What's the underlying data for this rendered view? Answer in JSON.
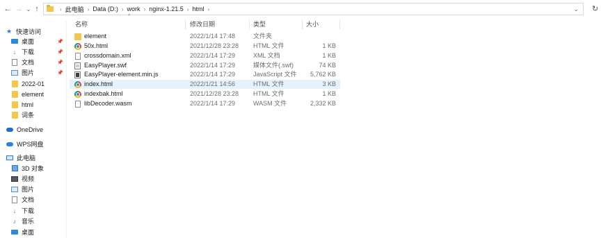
{
  "nav": {
    "back_icon": "arrow-left-icon",
    "forward_icon": "arrow-right-icon",
    "down_icon": "chevron-down-icon",
    "up_icon": "arrow-up-icon"
  },
  "address": {
    "crumbs": [
      "此电脑",
      "Data (D:)",
      "work",
      "nginx-1.21.5",
      "html"
    ]
  },
  "sidebar": {
    "quick_access": "快速访问",
    "items": [
      {
        "label": "桌面",
        "icon": "desktop-icon",
        "pinned": true
      },
      {
        "label": "下载",
        "icon": "download-icon",
        "pinned": true
      },
      {
        "label": "文档",
        "icon": "document-icon",
        "pinned": true
      },
      {
        "label": "图片",
        "icon": "picture-icon",
        "pinned": true
      },
      {
        "label": "2022-01",
        "icon": "folder-icon",
        "pinned": false
      },
      {
        "label": "element",
        "icon": "folder-icon",
        "pinned": false
      },
      {
        "label": "html",
        "icon": "folder-icon",
        "pinned": false
      },
      {
        "label": "词条",
        "icon": "folder-icon",
        "pinned": false
      }
    ],
    "onedrive": "OneDrive",
    "wps": "WPS网盘",
    "this_pc": "此电脑",
    "pc_items": [
      {
        "label": "3D 对象",
        "icon": "3d-objects-icon"
      },
      {
        "label": "视频",
        "icon": "video-icon"
      },
      {
        "label": "图片",
        "icon": "picture-icon"
      },
      {
        "label": "文档",
        "icon": "document-icon"
      },
      {
        "label": "下载",
        "icon": "download-icon"
      },
      {
        "label": "音乐",
        "icon": "music-icon"
      },
      {
        "label": "桌面",
        "icon": "desktop-icon"
      }
    ]
  },
  "columns": {
    "name": "名称",
    "date": "修改日期",
    "type": "类型",
    "size": "大小"
  },
  "files": [
    {
      "name": "element",
      "date": "2022/1/14 17:48",
      "type": "文件夹",
      "size": "",
      "icon": "folder-icon"
    },
    {
      "name": "50x.html",
      "date": "2021/12/28 23:28",
      "type": "HTML 文件",
      "size": "1 KB",
      "icon": "chrome-icon"
    },
    {
      "name": "crossdomain.xml",
      "date": "2022/1/14 17:29",
      "type": "XML 文档",
      "size": "1 KB",
      "icon": "xml-file-icon"
    },
    {
      "name": "EasyPlayer.swf",
      "date": "2022/1/14 17:29",
      "type": "媒体文件(.swf)",
      "size": "74 KB",
      "icon": "swf-file-icon"
    },
    {
      "name": "EasyPlayer-element.min.js",
      "date": "2022/1/14 17:29",
      "type": "JavaScript 文件",
      "size": "5,762 KB",
      "icon": "js-file-icon"
    },
    {
      "name": "index.html",
      "date": "2022/1/21 14:56",
      "type": "HTML 文件",
      "size": "3 KB",
      "icon": "chrome-icon",
      "selected": true
    },
    {
      "name": "indexbak.html",
      "date": "2021/12/28 23:28",
      "type": "HTML 文件",
      "size": "1 KB",
      "icon": "chrome-icon"
    },
    {
      "name": "libDecoder.wasm",
      "date": "2022/1/14 17:29",
      "type": "WASM 文件",
      "size": "2,332 KB",
      "icon": "file-icon"
    }
  ]
}
